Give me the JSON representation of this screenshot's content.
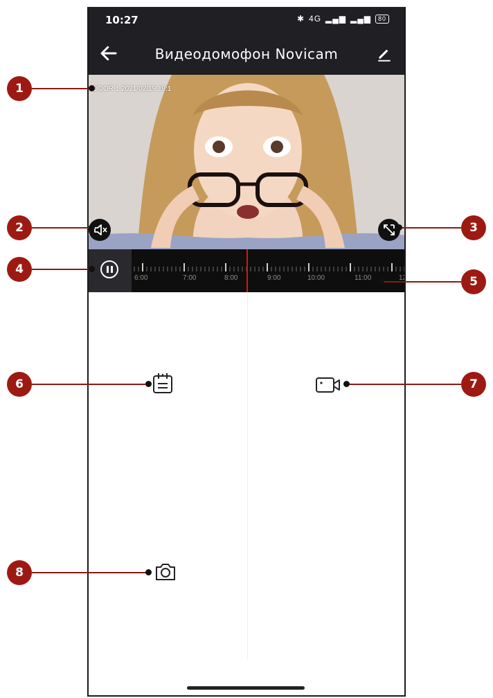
{
  "status_bar": {
    "time": "10:27",
    "network": "4G",
    "battery": "80"
  },
  "app_bar": {
    "title": "Видеодомофон Novicam"
  },
  "video": {
    "overlay_text": "DOOR 1 2021/02/19 19:1"
  },
  "timeline": {
    "labels": [
      "6:00",
      "7:00",
      "8:00",
      "9:00",
      "10:00",
      "11:00",
      "12"
    ]
  },
  "callouts": [
    "1",
    "2",
    "3",
    "4",
    "5",
    "6",
    "7",
    "8"
  ],
  "colors": {
    "callout": "#9d1a12",
    "playhead": "#dd1111",
    "bar": "#1f1f24"
  },
  "icons": {
    "back": "arrow-left-icon",
    "edit": "pencil-icon",
    "mute": "speaker-muted-icon",
    "fullscreen": "fullscreen-icon",
    "pause": "pause-icon",
    "records": "calendar-list-icon",
    "record": "video-camera-icon",
    "snapshot": "camera-icon"
  }
}
